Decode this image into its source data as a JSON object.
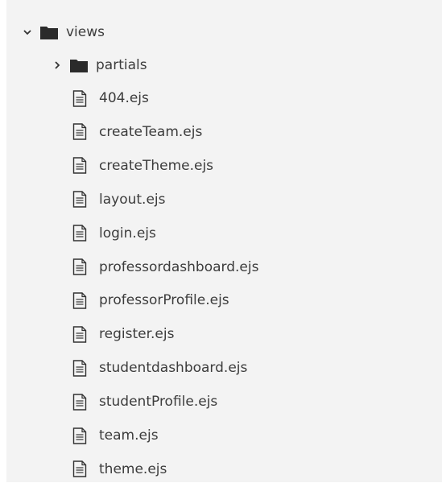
{
  "explorer": {
    "root_folder": {
      "name": "views",
      "expanded": true
    },
    "subfolder": {
      "name": "partials",
      "expanded": false
    },
    "files": [
      "404.ejs",
      "createTeam.ejs",
      "createTheme.ejs",
      "layout.ejs",
      "login.ejs",
      "professordashboard.ejs",
      "professorProfile.ejs",
      "register.ejs",
      "studentdashboard.ejs",
      "studentProfile.ejs",
      "team.ejs",
      "theme.ejs"
    ]
  },
  "icons": {
    "expanded": "chevron-down-icon",
    "collapsed": "chevron-right-icon",
    "folder": "folder-icon",
    "file": "file-icon"
  },
  "colors": {
    "panel_bg": "#f3f3f3",
    "text": "#3c3c3c",
    "icon": "#333333"
  }
}
